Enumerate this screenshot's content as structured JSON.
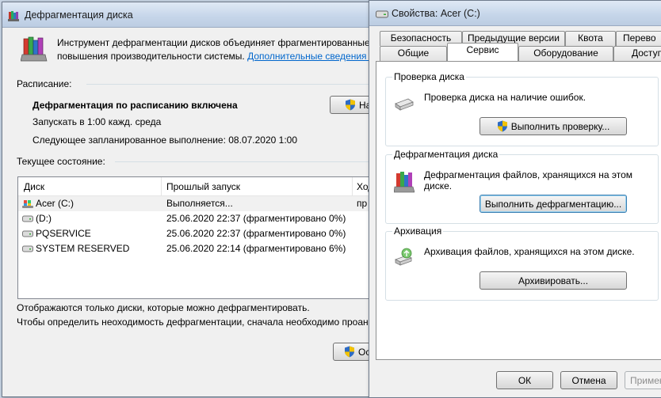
{
  "defrag_window": {
    "title": "Дефрагментация диска",
    "header_line1": "Инструмент дефрагментации дисков объединяет фрагментированные ф",
    "header_line2": "повышения производительности системы.",
    "header_link": "Дополнительные сведения о",
    "schedule_label": "Расписание:",
    "schedule_status": "Дефрагментация по расписанию включена",
    "schedule_run": "Запускать в 1:00 кажд. среда",
    "schedule_next": "Следующее запланированное выполнение: 08.07.2020 1:00",
    "configure_button": "На",
    "current_state_label": "Текущее состояние:",
    "columns": [
      "Диск",
      "Прошлый запуск",
      "Ход"
    ],
    "disks": [
      {
        "name": "Acer (C:)",
        "last_run": "Выполняется...",
        "progress": "пр"
      },
      {
        "name": "(D:)",
        "last_run": "25.06.2020 22:37 (фрагментировано 0%)",
        "progress": ""
      },
      {
        "name": "PQSERVICE",
        "last_run": "25.06.2020 22:37 (фрагментировано 0%)",
        "progress": ""
      },
      {
        "name": "SYSTEM RESERVED",
        "last_run": "25.06.2020 22:14 (фрагментировано 6%)",
        "progress": ""
      }
    ],
    "footer_line1": "Отображаются только диски, которые можно дефрагментировать.",
    "footer_line2": "Чтобы определить неоходимость  дефрагментации, сначала необходимо проана",
    "stop_button": "Ост"
  },
  "properties_window": {
    "title": "Свойства: Acer (C:)",
    "tabs_row1": [
      "Безопасность",
      "Предыдущие версии",
      "Квота",
      "Перево"
    ],
    "tabs_row2": [
      "Общие",
      "Сервис",
      "Оборудование",
      "Доступ"
    ],
    "active_tab": "Сервис",
    "groups": [
      {
        "title": "Проверка диска",
        "text1": "Проверка диска на наличие ошибок.",
        "text2": "",
        "button": "Выполнить проверку...",
        "icon": "disk-check-icon"
      },
      {
        "title": "Дефрагментация диска",
        "text1": "Дефрагментация файлов, хранящихся на этом",
        "text2": "диске.",
        "button": "Выполнить дефрагментацию...",
        "icon": "defrag-icon"
      },
      {
        "title": "Архивация",
        "text1": "Архивация файлов, хранящихся на этом диске.",
        "text2": "",
        "button": "Архивировать...",
        "icon": "backup-icon"
      }
    ],
    "ok_button": "ОК",
    "cancel_button": "Отмена",
    "apply_button": "Примен"
  },
  "colors": {
    "link": "#0066cc",
    "shield_blue": "#2d6bc4",
    "shield_yellow": "#f2c200",
    "selected_row": "#f1f1f1"
  }
}
